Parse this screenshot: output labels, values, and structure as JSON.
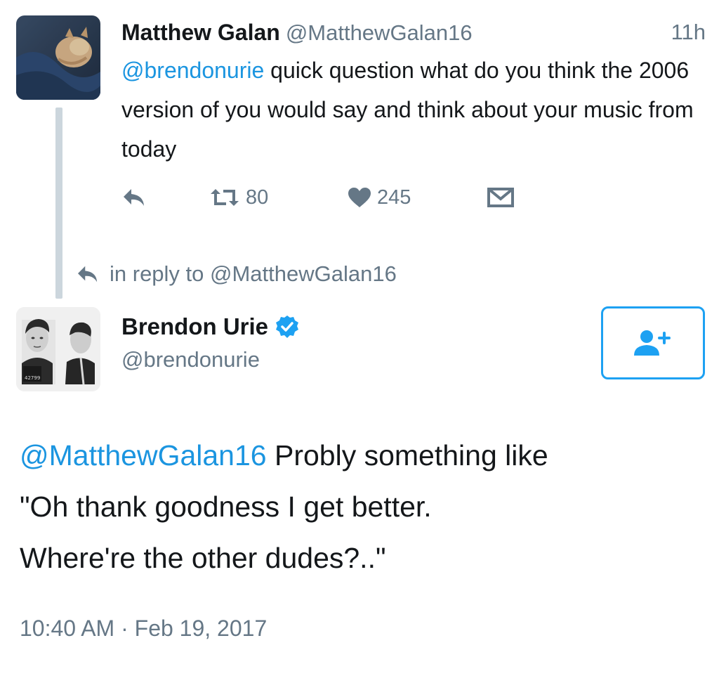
{
  "colors": {
    "link": "#1b95e0",
    "muted": "#657786",
    "text": "#14171a",
    "accent": "#1da1f2",
    "thread_line": "#ccd6dd"
  },
  "tweet1": {
    "author_name": "Matthew Galan",
    "author_handle": "@MatthewGalan16",
    "time": "11h",
    "mention": "@brendonurie",
    "text": " quick question what do you think the 2006 version of you would say and think about your music from today",
    "retweet_count": "80",
    "like_count": "245",
    "icons": [
      "reply-icon",
      "retweet-icon",
      "like-icon",
      "direct-message-icon"
    ]
  },
  "reply_context": {
    "text": "in reply to @MatthewGalan16"
  },
  "tweet2": {
    "author_name": "Brendon Urie",
    "author_handle": "@brendonurie",
    "verified": true,
    "mention": "@MatthewGalan16",
    "line1": " Probly something like",
    "line2": "\"Oh thank goodness I get better.",
    "line3": "Where're the other dudes?..\"",
    "time": "10:40 AM",
    "separator": "·",
    "date": "Feb 19, 2017",
    "follow_icon": "add-user-icon"
  }
}
